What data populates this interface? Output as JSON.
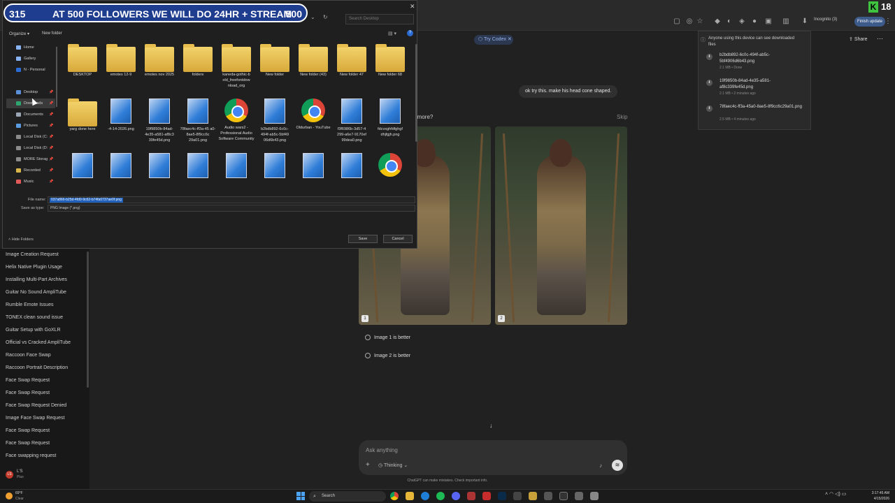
{
  "banner": {
    "left": "315",
    "middle": "AT 500 FOLLOWERS WE WILL DO 24HR + STREAM",
    "right": "500"
  },
  "kick": {
    "count": "18"
  },
  "browser": {
    "incognito": "Incognito (3)",
    "finish_update": "Finish update"
  },
  "dialog": {
    "search_placeholder": "Search Desktop",
    "organize": "Organize ▾",
    "new_folder": "New folder",
    "nav": [
      {
        "label": "Home",
        "color": "#8ab4f8"
      },
      {
        "label": "Gallery",
        "color": "#8ab4f8"
      },
      {
        "label": "N - Personal",
        "color": "#2b6cd4"
      },
      {
        "label": "Desktop",
        "color": "#5b8fd8",
        "pin": "📌"
      },
      {
        "label": "Downloads",
        "color": "#2fa56f",
        "pin": "📌"
      },
      {
        "label": "Documents",
        "color": "#9aa5b5",
        "pin": "📌"
      },
      {
        "label": "Pictures",
        "color": "#5b9be0",
        "pin": "📌"
      },
      {
        "label": "Local Disk (C:",
        "color": "#8a8a8a",
        "pin": "📌"
      },
      {
        "label": "Local Disk (D:",
        "color": "#8a8a8a",
        "pin": "📌"
      },
      {
        "label": "MORE Storag",
        "color": "#8a8a8a",
        "pin": "📌"
      },
      {
        "label": "Recorded",
        "color": "#d9b64a",
        "pin": "📌"
      },
      {
        "label": "Music",
        "color": "#e05a5a",
        "pin": "📌"
      }
    ],
    "files": [
      {
        "label": "DESKTOP",
        "kind": "folder"
      },
      {
        "label": "emotes 12-9",
        "kind": "folder"
      },
      {
        "label": "emotes nov 2025",
        "kind": "folder"
      },
      {
        "label": "folders",
        "kind": "folder"
      },
      {
        "label": "kaneda-gothic-b old_freefontdow nload_org",
        "kind": "folder"
      },
      {
        "label": "New folder",
        "kind": "folder"
      },
      {
        "label": "New folder (43)",
        "kind": "folder"
      },
      {
        "label": "New folder 47",
        "kind": "folder"
      },
      {
        "label": "New folder 68",
        "kind": "folder"
      },
      {
        "label": "yarg done here",
        "kind": "folder"
      },
      {
        "label": "-4-14-2026.png",
        "kind": "image"
      },
      {
        "label": "19f9850b-84ad-4e35-a581-af8c3 39fe45d.png",
        "kind": "image"
      },
      {
        "label": "78faec4c-ff3a-45 a0-8ae5-8f9cc6c 29a01.png",
        "kind": "image"
      },
      {
        "label": "Audio wars2 - Professional Audio Software Community",
        "kind": "chrome"
      },
      {
        "label": "b2bdb892-6c0c-494f-ab5c-5bf49 06d6b43.png",
        "kind": "image"
      },
      {
        "label": "Oldurban - YouTube",
        "kind": "chrome"
      },
      {
        "label": "f3f6986b-3d57-4 299-a6e7-9170ef 99dea0.png",
        "kind": "image"
      },
      {
        "label": "fdcvxghfdfghgf dhjfgjh.png",
        "kind": "image"
      },
      {
        "label": "",
        "kind": "image"
      },
      {
        "label": "",
        "kind": "image"
      },
      {
        "label": "",
        "kind": "image"
      },
      {
        "label": "",
        "kind": "image"
      },
      {
        "label": "",
        "kind": "image"
      },
      {
        "label": "",
        "kind": "image"
      },
      {
        "label": "",
        "kind": "image"
      },
      {
        "label": "",
        "kind": "image"
      },
      {
        "label": "",
        "kind": "chrome"
      }
    ],
    "file_name_label": "File name:",
    "file_name_value": "037a866-b25d-4fd0-9c62-b74fa0737ae0f.png",
    "save_type_label": "Save as type:",
    "save_type_value": "PNG Image (*.png)",
    "hide_folders": "Hide Folders",
    "save": "Save",
    "cancel": "Cancel"
  },
  "sidebar": {
    "items": [
      "Image Creation Request",
      "Helix Native Plugin Usage",
      "Installing Multi-Part Archives",
      "Guitar No Sound AmpliTube",
      "Rumble Emote Issues",
      "TONEX clean sound issue",
      "Guitar Setup with GoXLR",
      "Official vs Cracked AmpliTube",
      "Raccoon Face Swap",
      "Raccoon Portrait Description",
      "Face Swap Request",
      "Face Swap Request",
      "Face Swap Request Denied",
      "Image Face Swap Request",
      "Face Swap Request",
      "Face Swap Request",
      "Face swapping request"
    ],
    "user_initials": "LS",
    "user_name": "L'S",
    "user_plan": "Plus"
  },
  "chat": {
    "try_codex": "Try Codex",
    "share": "Share",
    "user_message": "ok try this. make his head cone shaped.",
    "prompt": "e more?",
    "skip": "Skip",
    "image1_num": "1",
    "image2_num": "2",
    "choice1": "Image 1 is better",
    "choice2": "Image 2 is better",
    "composer_placeholder": "Ask anything",
    "thinking": "Thinking",
    "disclaimer": "ChatGPT can make mistakes. Check important info."
  },
  "downloads": {
    "warning": "Anyone using this device can see downloaded files",
    "items": [
      {
        "name": "b2bdb892-6c0c-494f-ab5c-5bf4906d6b43.png",
        "meta": "2.1 MB • Done"
      },
      {
        "name": "19f9850b-84ad-4e35-a581-af8c339fe45d.png",
        "meta": "2.1 MB • 2 minutes ago"
      },
      {
        "name": "78faec4c-ff3a-45a0-8ae5-8f9cc6c29a01.png",
        "meta": "2.5 MB • 4 minutes ago"
      }
    ]
  },
  "taskbar": {
    "weather_temp": "69°F",
    "weather_cond": "Clear",
    "search": "Search",
    "time": "3:17:45 AM",
    "date": "4/15/2026"
  }
}
